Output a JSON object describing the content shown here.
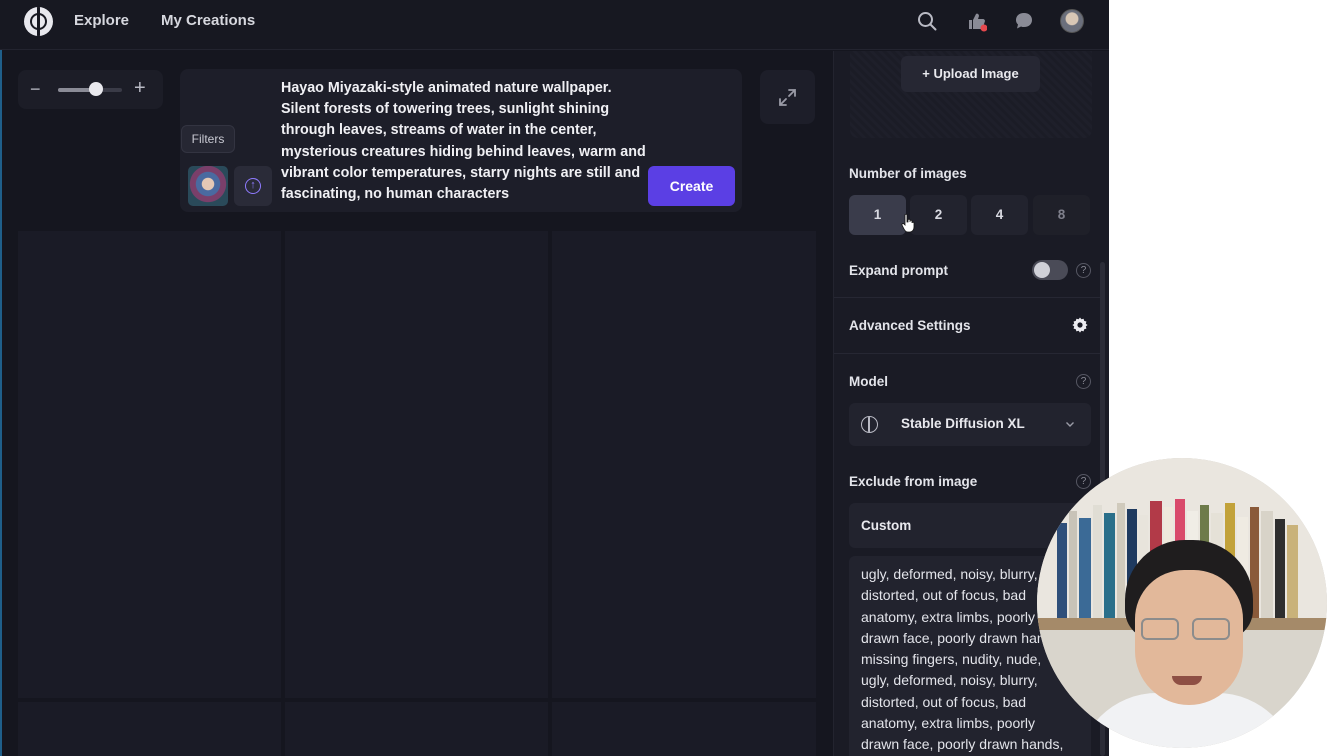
{
  "nav": {
    "explore": "Explore",
    "my_creations": "My Creations"
  },
  "icons": {
    "logo": "logo-icon",
    "search": "search-icon",
    "likes": "thumbs-up-icon",
    "chat": "chat-bubble-icon",
    "avatar": "avatar",
    "zoom_out": "minus-icon",
    "zoom_in": "plus-icon",
    "expand": "expand-arrows-icon",
    "upload": "upload-arrow-icon",
    "settings": "gear-icon",
    "dropdown": "chevron-down-icon",
    "help": "question-icon"
  },
  "colors": {
    "accent": "#5b3fe4",
    "notification": "#e5484d",
    "background": "#15161f"
  },
  "zoom": {
    "minus": "−",
    "plus": "+",
    "level": 0.6
  },
  "prompt": {
    "text": "Hayao Miyazaki-style animated nature wallpaper. Silent forests of towering trees, sunlight shining through leaves, streams of water in the center, mysterious creatures hiding behind leaves, warm and vibrant color temperatures, starry nights are still and fascinating, no human characters",
    "filters_label": "Filters",
    "upload_glyph": "↑",
    "create_label": "Create"
  },
  "panel": {
    "upload_label": "+   Upload Image",
    "number_of_images_label": "Number of images",
    "counts": [
      "1",
      "2",
      "4",
      "8"
    ],
    "selected_count": "1",
    "expand_prompt_label": "Expand prompt",
    "expand_prompt_on": false,
    "advanced_settings_label": "Advanced Settings",
    "model_label": "Model",
    "model_value": "Stable Diffusion XL",
    "exclude_label": "Exclude from image",
    "exclude_mode": "Custom",
    "exclude_text": "ugly, deformed, noisy, blurry, distorted, out of focus, bad anatomy, extra limbs, poorly drawn face, poorly drawn hands, missing fingers, nudity, nude, ugly, deformed, noisy, blurry, distorted, out of focus, bad anatomy, extra limbs, poorly drawn face, poorly drawn hands, missing fingers,",
    "help_glyph": "?"
  }
}
